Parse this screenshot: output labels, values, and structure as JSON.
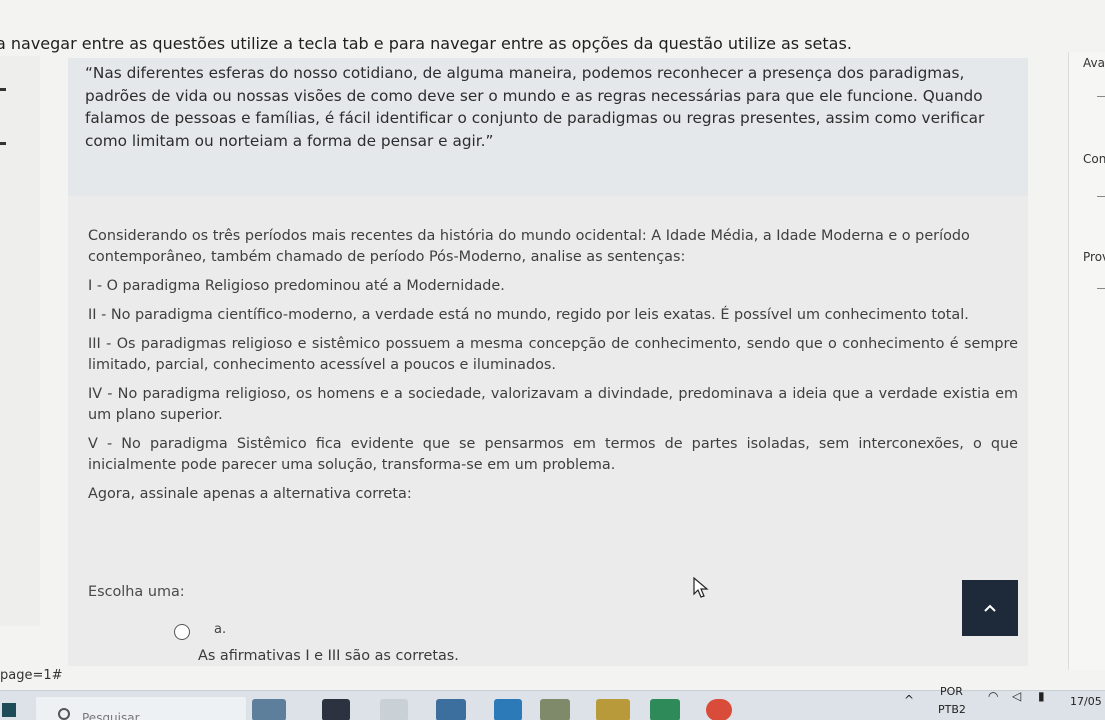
{
  "instruction": "a navegar entre as questões utilize a tecla tab e para navegar entre as opções da questão utilize as setas.",
  "right_panel": {
    "label_1": "Ava",
    "label_2": "Con",
    "label_3": "Prov"
  },
  "question": {
    "quote": "“Nas diferentes esferas do nosso cotidiano, de alguma maneira, podemos reconhecer a presença dos paradigmas, padrões de vida ou nossas visões de como deve ser o mundo e as regras necessárias para que ele funcione. Quando falamos de pessoas e famílias, é fácil identificar o conjunto de paradigmas ou regras presentes, assim como verificar como limitam ou norteiam a forma de pensar e agir.”",
    "intro": "Considerando os três períodos mais recentes da história do mundo ocidental: A Idade Média, a Idade Moderna e o período contemporâneo, também chamado de período Pós-Moderno, analise as sentenças:",
    "statements": [
      "I - O paradigma Religioso predominou até a Modernidade.",
      "II - No paradigma científico-moderno, a verdade está no mundo, regido por leis exatas. É possível um conhecimento total.",
      "III - Os paradigmas religioso e sistêmico possuem a mesma concepção de conhecimento, sendo que o conhecimento é sempre limitado, parcial, conhecimento acessível a poucos e iluminados.",
      "IV - No paradigma religioso, os homens e a sociedade, valorizavam a divindade, predominava a ideia que a verdade existia em um plano superior.",
      "V - No paradigma Sistêmico fica evidente que se pensarmos em termos de partes isoladas, sem interconexões, o que inicialmente pode parecer uma solução, transforma-se em um problema."
    ],
    "prompt": "Agora, assinale apenas a alternativa correta:",
    "choose_label": "Escolha uma:",
    "option_a_letter": "a.",
    "option_a_text": "As afirmativas I e III são as corretas."
  },
  "page_label": "page=1#",
  "taskbar": {
    "search_placeholder": "Pesquisar",
    "lang": "POR",
    "layout": "PTB2",
    "date": "17/05"
  },
  "colors": {
    "scroll_button": "#1e2a3a",
    "quote_bg": "#e5e8ea",
    "content_bg": "#ebebeb"
  }
}
